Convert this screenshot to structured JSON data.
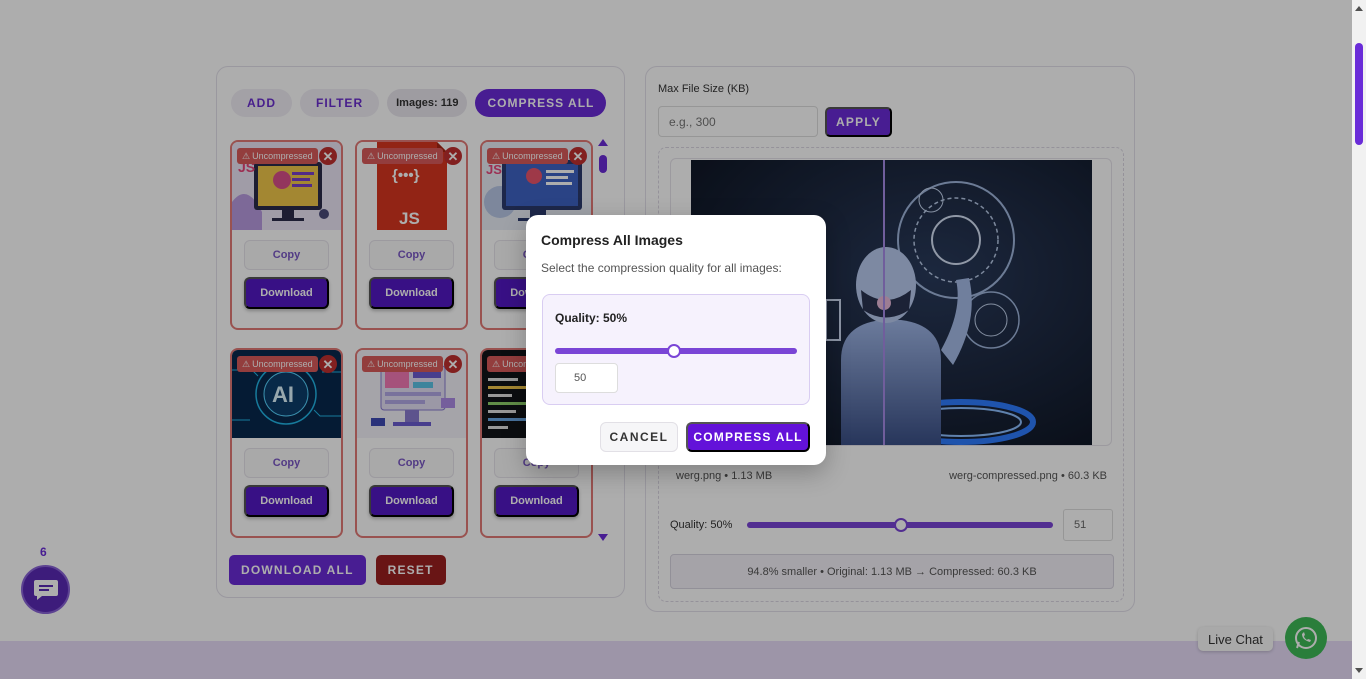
{
  "toolbar": {
    "add_label": "ADD",
    "filter_label": "FILTER",
    "images_count": "Images: 119",
    "compress_all_label": "COMPRESS ALL"
  },
  "cards": [
    {
      "badge": "Uncompressed",
      "copy": "Copy",
      "download": "Download",
      "thumb": "js-monitor"
    },
    {
      "badge": "Uncompressed",
      "copy": "Copy",
      "download": "Download",
      "thumb": "js-file"
    },
    {
      "badge": "Uncompressed",
      "copy": "Copy",
      "download": "Download",
      "thumb": "js-screen"
    },
    {
      "badge": "Uncompressed",
      "copy": "Copy",
      "download": "Download",
      "thumb": "ai-chip"
    },
    {
      "badge": "Uncompressed",
      "copy": "Copy",
      "download": "Download",
      "thumb": "dashboard"
    },
    {
      "badge": "Uncompressed",
      "copy": "Copy",
      "download": "Download",
      "thumb": "code-screen"
    }
  ],
  "bottom_actions": {
    "download_all_label": "DOWNLOAD ALL",
    "reset_label": "RESET"
  },
  "right_panel": {
    "max_file_size_label": "Max File Size (KB)",
    "max_file_size_placeholder": "e.g., 300",
    "apply_label": "APPLY",
    "original_file": "werg.png • 1.13 MB",
    "compressed_file": "werg-compressed.png • 60.3 KB",
    "quality_label": "Quality: 50%",
    "quality_value": 50,
    "quality_input": "51",
    "summary": "94.8% smaller • Original: 1.13 MB → Compressed: 60.3 KB"
  },
  "modal": {
    "title": "Compress All Images",
    "subtitle": "Select the compression quality for all images:",
    "quality_label": "Quality: 50%",
    "quality_value": 50,
    "quality_input": "50",
    "cancel_label": "CANCEL",
    "compress_label": "COMPRESS ALL"
  },
  "chat": {
    "unread_count": "6",
    "live_chat_label": "Live Chat"
  },
  "colors": {
    "accent": "#6a2cd8",
    "danger": "#9b1f1f",
    "badge": "#d95b5b",
    "whatsapp": "#3fba58"
  }
}
